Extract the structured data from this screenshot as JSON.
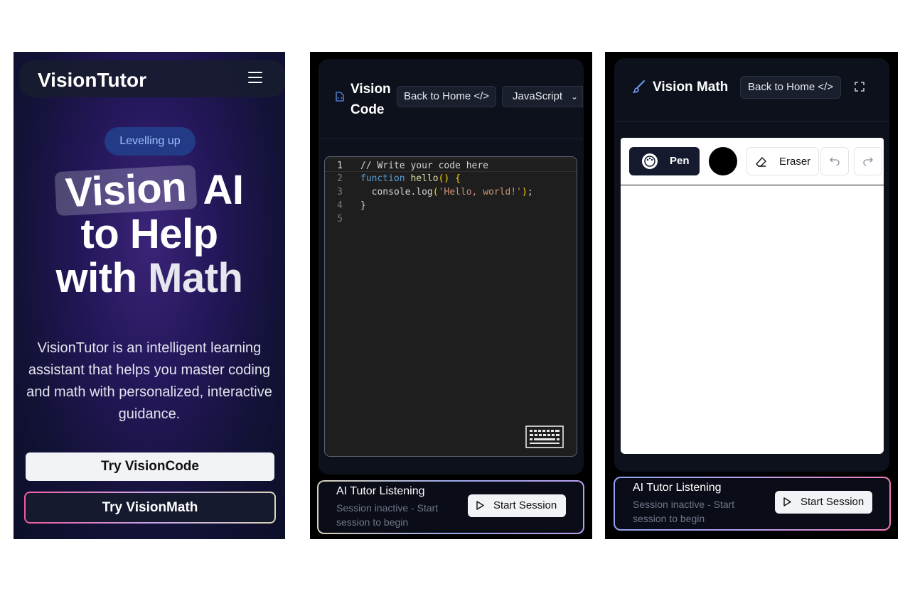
{
  "landing": {
    "brand": "VisionTutor",
    "badge": "Levelling up",
    "headline": {
      "box_word": "Vision",
      "word2": "AI",
      "line2": "to Help",
      "line3_a": "with",
      "line3_b": "Math"
    },
    "description": "VisionTutor is an intelligent learning assistant that helps you master coding and math with personalized, interactive guidance.",
    "buttons": {
      "code": "Try VisionCode",
      "math": "Try VisionMath"
    },
    "icons": {
      "menu": "hamburger-menu-icon"
    }
  },
  "vision_code": {
    "title_line1": "Vision",
    "title_line2": "Code",
    "back_button": "Back to Home </>",
    "language": "JavaScript",
    "line_numbers": [
      "1",
      "2",
      "3",
      "4",
      "5"
    ],
    "code_lines": [
      "// Write your code here",
      "function hello() {",
      "  console.log('Hello, world!');",
      "}",
      ""
    ],
    "code_tokens": {
      "comment": "// Write your code here",
      "kw_function": "function",
      "fn_name": " hello",
      "paren_brace": "() {",
      "indent": "  ",
      "console_log": "console.log",
      "open_paren": "(",
      "string": "'Hello, world!'",
      "close_paren": ")",
      "semicolon": ";",
      "close_brace": "}"
    },
    "tutor": {
      "title": "AI Tutor Listening",
      "status": "Session inactive - Start session to begin",
      "button": "Start Session"
    },
    "icons": {
      "file": "code-file-icon",
      "keyboard": "keyboard-icon",
      "play": "play-icon",
      "chevron": "chevron-down-icon"
    }
  },
  "vision_math": {
    "title": "Vision Math",
    "back_button": "Back to Home </>",
    "toolbar": {
      "pen": "Pen",
      "eraser": "Eraser",
      "color": "#000000"
    },
    "tutor": {
      "title": "AI Tutor Listening",
      "status": "Session inactive - Start session to begin",
      "button": "Start Session"
    },
    "icons": {
      "brush": "brush-icon",
      "fullscreen": "fullscreen-icon",
      "palette": "palette-icon",
      "eraser": "eraser-icon",
      "undo": "undo-icon",
      "redo": "redo-icon"
    }
  },
  "colors": {
    "panel_bg": "#0d111c",
    "badge_bg": "#233a86",
    "badge_text": "#9fc0ff",
    "comment": "#6a9955",
    "keyword": "#569cd6",
    "function": "#dcdcaa",
    "string": "#ce9178",
    "bracket": "#ffd700"
  }
}
